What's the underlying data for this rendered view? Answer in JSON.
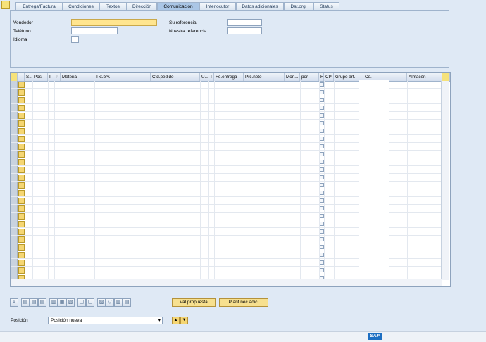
{
  "tabs": [
    {
      "label": "Entrega/Factura",
      "active": false
    },
    {
      "label": "Condiciones",
      "active": false
    },
    {
      "label": "Textos",
      "active": false
    },
    {
      "label": "Dirección",
      "active": false
    },
    {
      "label": "Comunicación",
      "active": true
    },
    {
      "label": "Interlocutor",
      "active": false
    },
    {
      "label": "Datos adicionales",
      "active": false
    },
    {
      "label": "Dat.org.",
      "active": false
    },
    {
      "label": "Status",
      "active": false
    }
  ],
  "header": {
    "vendedor_label": "Vendedor",
    "vendedor_value": "",
    "telefono_label": "Teléfono",
    "telefono_value": "",
    "idioma_label": "Idioma",
    "idioma_value": "",
    "su_referencia_label": "Su referencia",
    "su_referencia_value": "",
    "nuestra_referencia_label": "Nuestra referencia",
    "nuestra_referencia_value": ""
  },
  "table": {
    "columns": [
      "S...",
      "Pos",
      "I",
      "P",
      "Material",
      "Txt.brv.",
      "Ctd.pedido",
      "U...",
      "T",
      "Fe.entrega",
      "Prc.neto",
      "Mon...",
      "por",
      "F",
      "CPP",
      "Grupo art.",
      "Ce.",
      "Almacén"
    ],
    "row_count": 26
  },
  "toolbar": {
    "val_propuesta": "Val.propuesta",
    "planf_nec_adic": "Planf.nec.adic."
  },
  "position": {
    "label": "Posición",
    "selected": "Posición nueva"
  },
  "brand": {
    "logo": "SAP",
    "color": "#1d6fc2"
  },
  "icons": [
    "detail-icon",
    "settings-icon",
    "grid-config-icon",
    "search-icon",
    "delete-icon",
    "copy-icon",
    "filter-icon",
    "chevron-up-icon",
    "chevron-down-icon",
    "dropdown-icon"
  ]
}
